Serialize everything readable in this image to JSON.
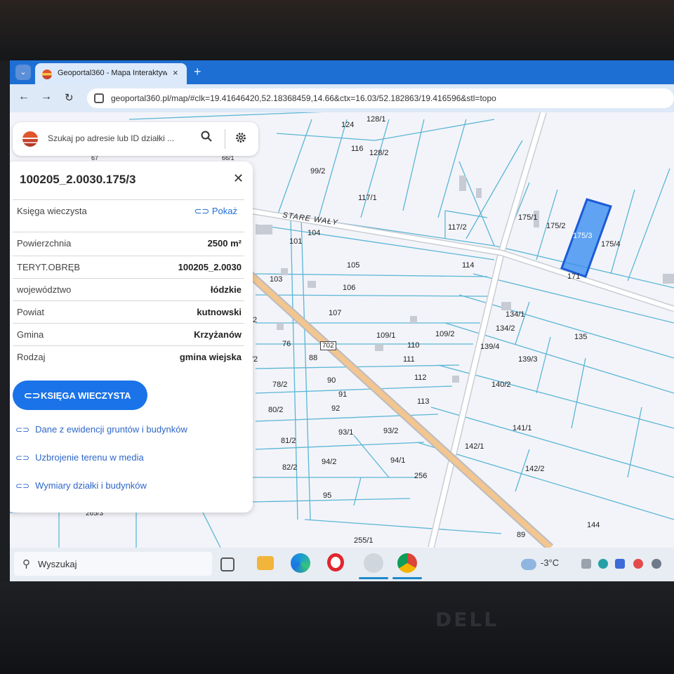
{
  "browser": {
    "tab_title": "Geoportal360 - Mapa Interaktyw",
    "tab_close": "×",
    "new_tab": "+",
    "url": "geoportal360.pl/map/#clk=19.41646420,52.18368459,14.66&ctx=16.03/52.182863/19.416596&stl=topo"
  },
  "search": {
    "placeholder": "Szukaj po adresie lub ID działki ..."
  },
  "panel": {
    "title": "100205_2.0030.175/3",
    "close": "✕",
    "rows": [
      {
        "key": "Księga wieczysta",
        "link": "Pokaż"
      },
      {
        "key": "Powierzchnia",
        "value": "2500 m²"
      },
      {
        "key": "TERYT.OBRĘB",
        "value": "100205_2.0030"
      },
      {
        "key": "województwo",
        "value": "łódzkie"
      },
      {
        "key": "Powiat",
        "value": "kutnowski"
      },
      {
        "key": "Gmina",
        "value": "Krzyżanów"
      },
      {
        "key": "Rodzaj",
        "value": "gmina wiejska"
      }
    ],
    "primary_button": "KSIĘGA WIECZYSTA",
    "links": [
      "Dane z ewidencji gruntów i budynków",
      "Uzbrojenie terenu w media",
      "Wymiary działki i budynków"
    ]
  },
  "map": {
    "street_label": "STARE WAŁY",
    "road_number": "702",
    "selected_parcel": "175/3",
    "highlight_color": "#3b8ff0",
    "parcel_line_color": "#5ab6d6",
    "parcels": [
      "128/1",
      "124",
      "116",
      "128/2",
      "99/2",
      "117/1",
      "104",
      "101",
      "117/2",
      "175/1",
      "175/2",
      "175/3",
      "175/4",
      "171",
      "105",
      "114",
      "103",
      "106",
      "107",
      "134/1",
      "134/2",
      "135",
      "2",
      "109/1",
      "109/2",
      "110",
      "139/4",
      "139/3",
      "76",
      "88",
      "111",
      "/2",
      "112",
      "140/2",
      "78/2",
      "90",
      "91",
      "113",
      "80/2",
      "92",
      "141/1",
      "93/1",
      "93/2",
      "81/2",
      "142/1",
      "82/2",
      "94/2",
      "94/1",
      "142/2",
      "256",
      "95",
      "144",
      "265/3",
      "89",
      "255/1",
      "67",
      "66/1"
    ]
  },
  "taskbar": {
    "search_placeholder": "Wyszukaj",
    "temperature": "-3°C"
  },
  "hardware": {
    "brand": "DELL"
  }
}
